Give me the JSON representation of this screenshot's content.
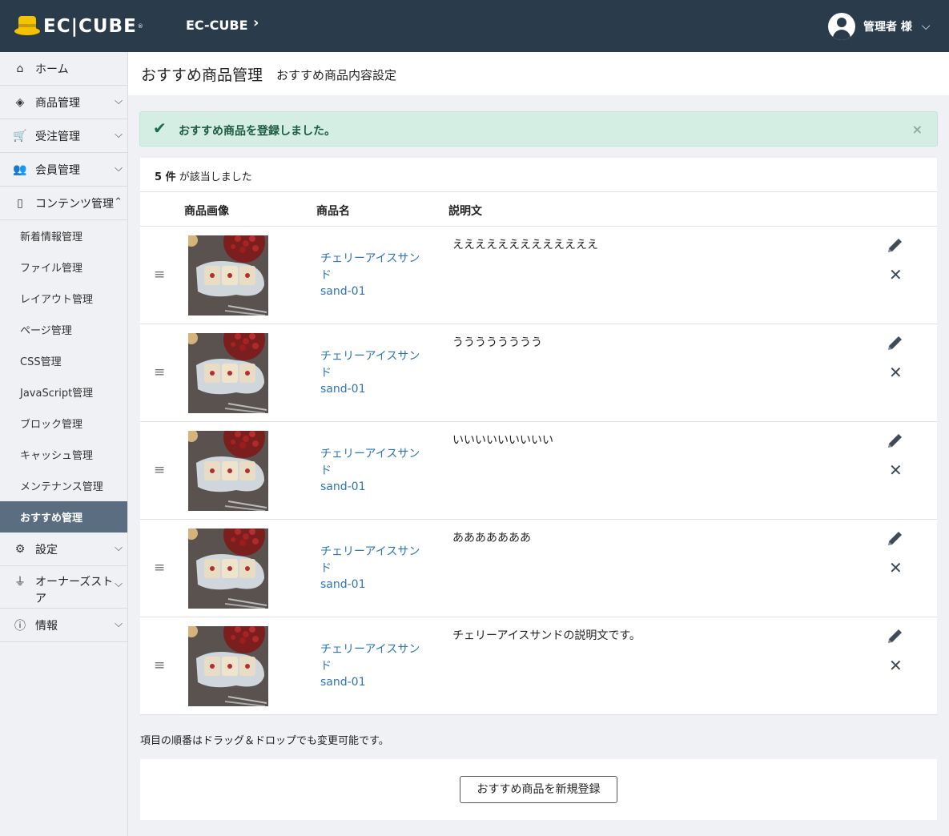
{
  "header": {
    "logo_text": "EC|CUBE",
    "logo_mark": "®",
    "shop_name": "EC-CUBE",
    "user_name": "管理者 様"
  },
  "sidebar": {
    "items": [
      {
        "label": "ホーム",
        "icon": "home-icon"
      },
      {
        "label": "商品管理",
        "icon": "cube-icon"
      },
      {
        "label": "受注管理",
        "icon": "cart-icon"
      },
      {
        "label": "会員管理",
        "icon": "users-icon"
      },
      {
        "label": "コンテンツ管理",
        "icon": "file-icon"
      }
    ],
    "content_sub": [
      "新着情報管理",
      "ファイル管理",
      "レイアウト管理",
      "ページ管理",
      "CSS管理",
      "JavaScript管理",
      "ブロック管理",
      "キャッシュ管理",
      "メンテナンス管理",
      "おすすめ管理"
    ],
    "bottom_items": [
      {
        "label": "設定",
        "icon": "gear-icon"
      },
      {
        "label": "オーナーズストア",
        "icon": "plug-icon"
      },
      {
        "label": "情報",
        "icon": "info-icon"
      }
    ]
  },
  "page": {
    "title": "おすすめ商品管理",
    "subtitle": "おすすめ商品内容設定"
  },
  "alert": {
    "message": "おすすめ商品を登録しました。",
    "close": "×"
  },
  "list": {
    "count": "5 件",
    "count_suffix": " が該当しました",
    "columns": [
      "商品画像",
      "商品名",
      "説明文"
    ],
    "rows": [
      {
        "name": "チェリーアイスサンド",
        "code": "sand-01",
        "description": "えええええええええええええ"
      },
      {
        "name": "チェリーアイスサンド",
        "code": "sand-01",
        "description": "うううううううう"
      },
      {
        "name": "チェリーアイスサンド",
        "code": "sand-01",
        "description": "いいいいいいいいい"
      },
      {
        "name": "チェリーアイスサンド",
        "code": "sand-01",
        "description": "あああああああ"
      },
      {
        "name": "チェリーアイスサンド",
        "code": "sand-01",
        "description": "チェリーアイスサンドの説明文です。"
      }
    ]
  },
  "note": "項目の順番はドラッグ＆ドロップでも変更可能です。",
  "new_button": "おすすめ商品を新規登録",
  "colors": {
    "header_bg": "#2a3b4c",
    "active_sidebar": "#5b6d80",
    "alert_bg": "#d4eee3",
    "link": "#2e75b6"
  }
}
